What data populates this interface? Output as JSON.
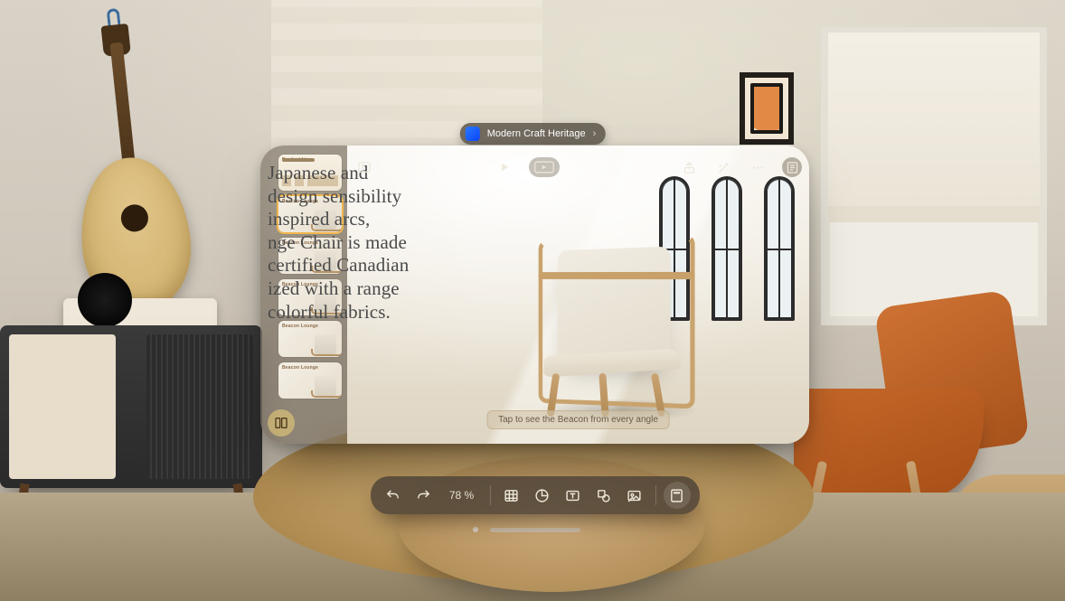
{
  "title_bar": {
    "app_icon": "keynote-app-icon",
    "document_name": "Modern Craft Heritage",
    "chevron": "›"
  },
  "navigator": {
    "thumbnails": [
      {
        "index": 8,
        "label": "Product Line"
      },
      {
        "index": 9,
        "label": "Beacon Lounge",
        "selected": true
      },
      {
        "index": 10,
        "label": "Beacon Lounge"
      },
      {
        "index": 11,
        "label": "Beacon Lounge"
      },
      {
        "index": 12,
        "label": "Beacon Lounge"
      },
      {
        "index": 13,
        "label": "Beacon Lounge"
      }
    ],
    "view_button_icon": "navigator-view-icon"
  },
  "canvas_toolbar": {
    "left": [
      "sidebar-toggle-icon"
    ],
    "center": [
      "play-icon",
      "present-window-icon"
    ],
    "right": [
      "share-icon",
      "magic-wand-icon",
      "more-icon",
      "inspector-icon"
    ]
  },
  "slide": {
    "text_lines": [
      "Japanese and",
      "design sensibility",
      "inspired arcs,",
      "nge Chair is made",
      "certified Canadian",
      "ized with a range",
      "colorful fabrics."
    ],
    "object_name": "Beacon Lounge Chair",
    "tap_hint": "Tap to see the Beacon from every angle"
  },
  "bottom_toolbar": {
    "undo_icon": "undo-icon",
    "redo_icon": "redo-icon",
    "zoom_label": "78 %",
    "tools": [
      "insert-table-icon",
      "insert-chart-icon",
      "insert-text-icon",
      "insert-shape-icon",
      "insert-media-icon"
    ],
    "format_icon": "format-panel-icon"
  }
}
